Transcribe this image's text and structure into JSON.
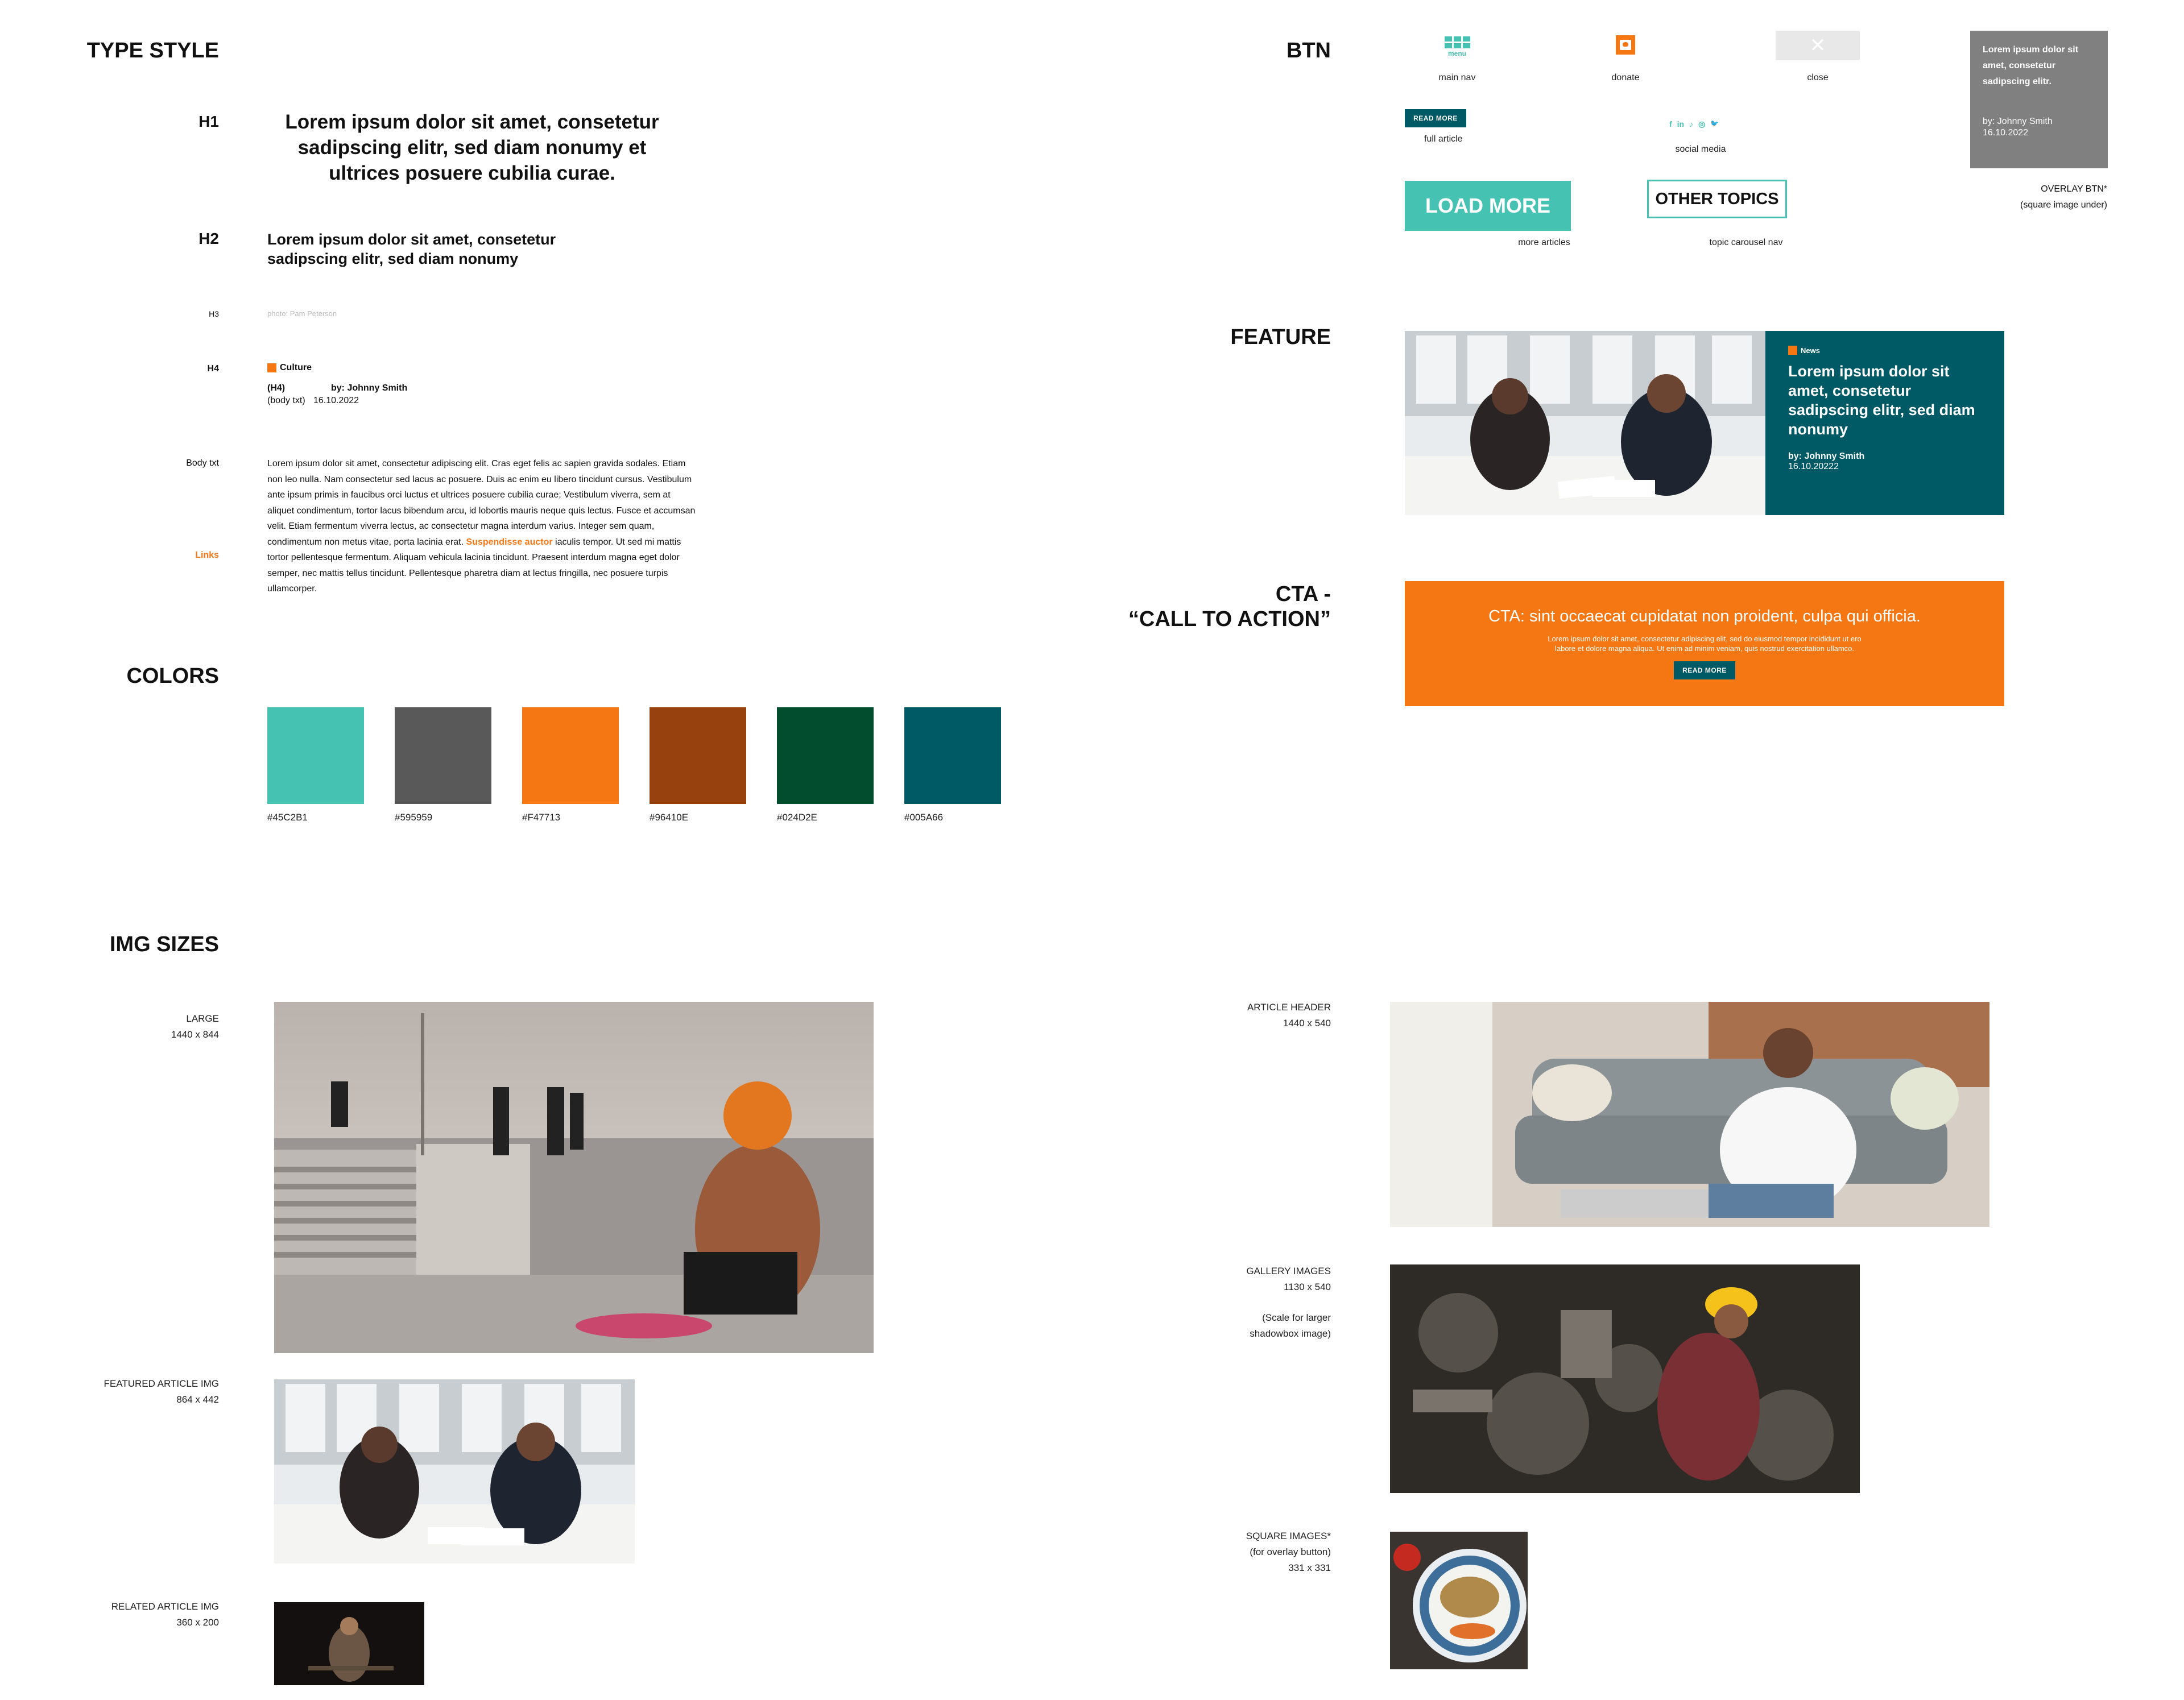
{
  "colors": {
    "teal": "#45C2B1",
    "gray": "#595959",
    "orange": "#F47713",
    "brown": "#96410E",
    "green": "#024D2E",
    "petrol": "#005A66",
    "overlay": "#808080"
  },
  "type_style": {
    "title": "TYPE STYLE",
    "h1_label": "H1",
    "h1_text": "Lorem ipsum dolor sit amet, consetetur sadipscing elitr, sed diam nonumy et ultrices posuere cubilia curae.",
    "h2_label": "H2",
    "h2_text": "Lorem ipsum dolor sit amet, consetetur sadipscing elitr, sed diam nonumy",
    "h3_label": "H3",
    "h3_text": "photo: Pam Peterson",
    "h4_label": "H4",
    "h4_category": "Culture",
    "h4_marker": "(H4)",
    "h4_byline": "by: Johnny Smith",
    "h4_body_marker": "(body txt)",
    "h4_date": "16.10.2022",
    "body_label": "Body txt",
    "links_label": "Links",
    "body_before_link": "Lorem ipsum dolor sit amet, consectetur adipiscing elit. Cras eget felis ac sapien gravida sodales. Etiam non leo nulla. Nam consectetur sed lacus ac posuere. Duis ac enim eu libero tincidunt cursus. Vestibulum ante ipsum primis in faucibus orci luctus et ultrices posuere cubilia curae; Vestibulum viverra, sem at aliquet condimentum, tortor lacus bibendum arcu, id lobortis mauris neque quis lectus. Fusce et accumsan velit. Etiam fermentum viverra lectus, ac consectetur magna interdum varius. Integer sem quam, condimentum non metus vitae, porta lacinia erat. ",
    "body_link": "Suspendisse auctor",
    "body_after_link": " iaculis tempor. Ut sed mi mattis tortor pellentesque fermentum. Aliquam vehicula lacinia tincidunt. Praesent interdum magna eget dolor semper, nec mattis tellus tincidunt. Pellentesque pharetra diam at lectus fringilla, nec posuere turpis ullamcorper."
  },
  "colors_section": {
    "title": "COLORS",
    "swatches": [
      {
        "hex": "#45C2B1",
        "label": "#45C2B1"
      },
      {
        "hex": "#595959",
        "label": "#595959"
      },
      {
        "hex": "#F47713",
        "label": "#F47713"
      },
      {
        "hex": "#96410E",
        "label": "#96410E"
      },
      {
        "hex": "#024D2E",
        "label": "#024D2E"
      },
      {
        "hex": "#005A66",
        "label": "#005A66"
      }
    ]
  },
  "btn": {
    "title": "BTN",
    "menu_text": "menu",
    "main_nav": "main nav",
    "donate": "donate",
    "close": "close",
    "close_glyph": "✕",
    "read_more": "READ MORE",
    "full_article": "full article",
    "social_icons": [
      "f",
      "in",
      "♪",
      "◎",
      "🐦"
    ],
    "social_media": "social media",
    "load_more": "LOAD MORE",
    "more_articles": "more articles",
    "other_topics": "OTHER TOPICS",
    "topic_carousel": "topic carousel  nav",
    "overlay_title": "Lorem ipsum dolor sit amet, consetetur sadipscing elitr.",
    "overlay_by": "by: Johnny Smith",
    "overlay_date": "16.10.2022",
    "overlay_label": "OVERLAY BTN*",
    "overlay_sub": "(square image  under)"
  },
  "feature": {
    "title": "FEATURE",
    "category": "News",
    "headline": "Lorem ipsum dolor sit amet, consetetur sadipscing elitr, sed diam nonumy",
    "byline": "by: Johnny Smith",
    "date": "16.10.20222"
  },
  "cta": {
    "title_line1": "CTA -",
    "title_line2": "“CALL TO ACTION”",
    "headline": "CTA: sint occaecat cupidatat non proident, culpa qui officia.",
    "body_line1": "Lorem ipsum dolor sit amet, consectetur adipiscing elit, sed do eiusmod tempor incididunt ut ero",
    "body_line2": "labore et dolore magna aliqua. Ut enim ad minim veniam, quis nostrud exercitation ullamco.",
    "button": "READ MORE"
  },
  "img_sizes": {
    "title": "IMG SIZES",
    "large_label": "LARGE",
    "large_size": "1440 x 844",
    "featured_label": "FEATURED ARTICLE IMG",
    "featured_size": "864 x 442",
    "related_label": "RELATED ARTICLE IMG",
    "related_size": "360 x 200",
    "header_label": "ARTICLE HEADER",
    "header_size": "1440 x 540",
    "gallery_label": "GALLERY IMAGES",
    "gallery_size": "1130 x 540",
    "gallery_note1": "(Scale for larger",
    "gallery_note2": "shadowbox image)",
    "square_label": "SQUARE IMAGES*",
    "square_note": "(for overlay button)",
    "square_size": "331 x 331"
  }
}
